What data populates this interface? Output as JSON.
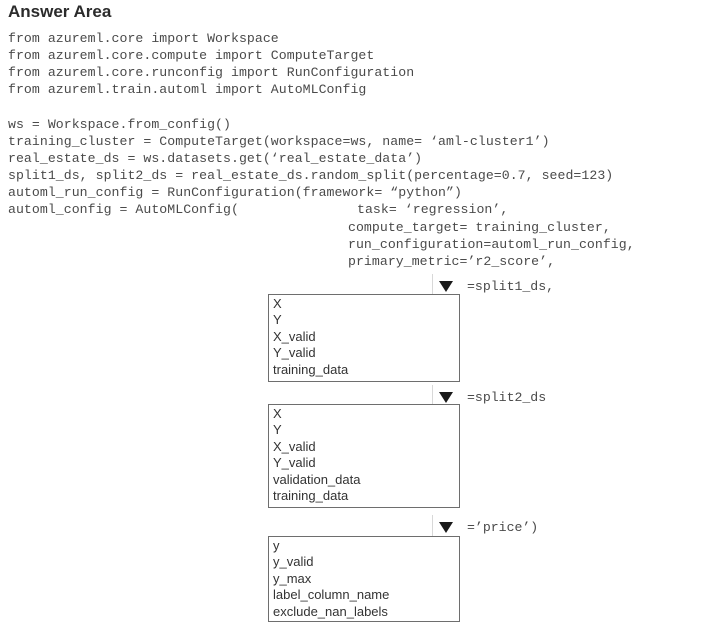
{
  "title": "Answer Area",
  "code": {
    "imports": [
      "from azureml.core import Workspace",
      "from azureml.core.compute import ComputeTarget",
      "from azureml.core.runconfig import RunConfiguration",
      "from azureml.train.automl import AutoMLConfig"
    ],
    "body": [
      "ws = Workspace.from_config()",
      "training_cluster = ComputeTarget(workspace=ws, name= ‘aml-cluster1’)",
      "real_estate_ds = ws.datasets.get(‘real_estate_data’)",
      "split1_ds, split2_ds = real_estate_ds.random_split(percentage=0.7, seed=123)",
      "automl_run_config = RunConfiguration(framework= “python”)",
      "automl_config = AutoMLConfig("
    ],
    "task_arg": "task= ‘regression’,",
    "args": [
      "compute_target= training_cluster,",
      "run_configuration=automl_run_config,",
      "primary_metric=’r2_score’,"
    ]
  },
  "dropdowns": [
    {
      "icon": "dropdown-arrow-icon",
      "suffix": "=split1_ds,",
      "options": [
        "X",
        "Y",
        "X_valid",
        "Y_valid",
        "training_data"
      ]
    },
    {
      "icon": "dropdown-arrow-icon",
      "suffix": "=split2_ds",
      "options": [
        "X",
        "Y",
        "X_valid",
        "Y_valid",
        "validation_data",
        "training_data"
      ]
    },
    {
      "icon": "dropdown-arrow-icon",
      "suffix": "=’price’)",
      "options": [
        "y",
        "y_valid",
        "y_max",
        "label_column_name",
        "exclude_nan_labels"
      ]
    }
  ]
}
